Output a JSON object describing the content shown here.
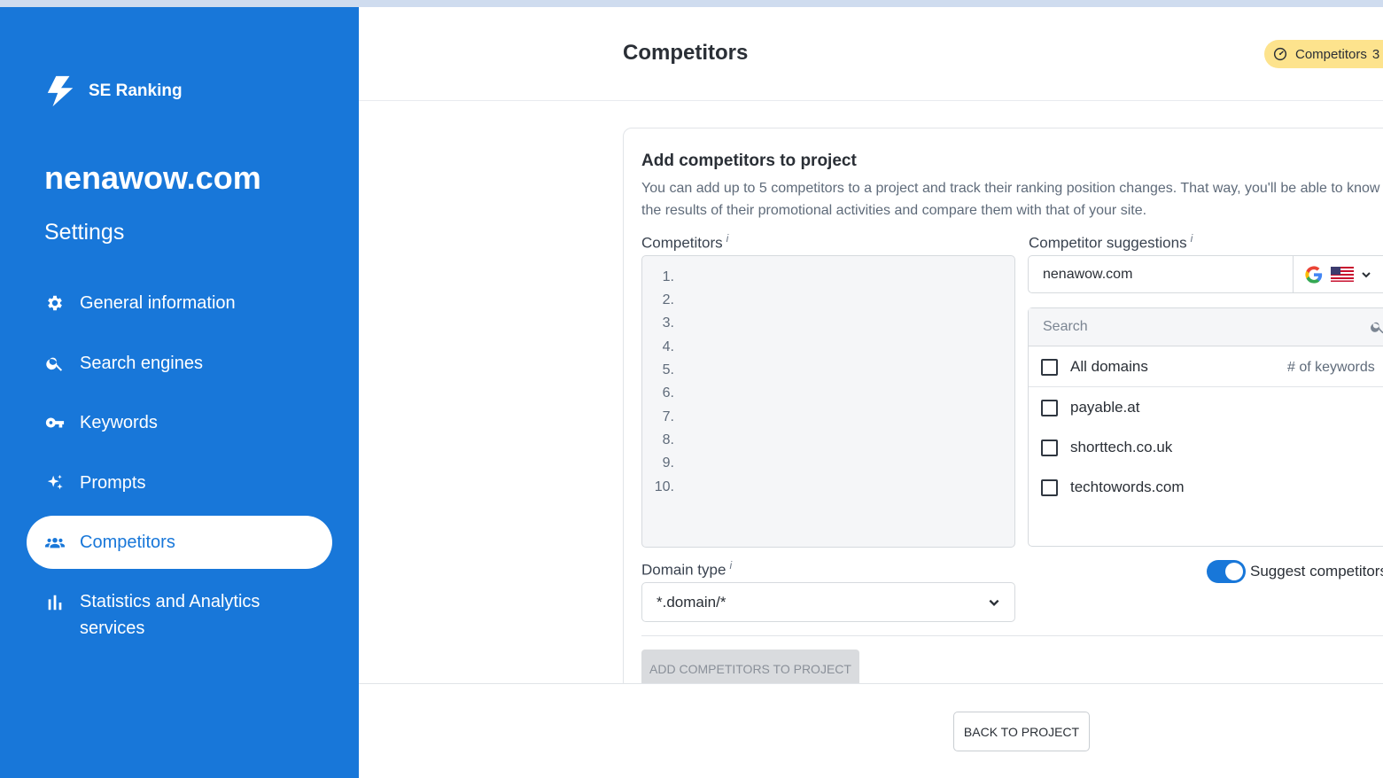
{
  "brand": {
    "name": "SE Ranking"
  },
  "project": {
    "name": "nenawow.com",
    "section": "Settings"
  },
  "nav": {
    "items": [
      {
        "label": "General information",
        "icon": "gear-icon",
        "active": false
      },
      {
        "label": "Search engines",
        "icon": "search-icon",
        "active": false
      },
      {
        "label": "Keywords",
        "icon": "key-icon",
        "active": false
      },
      {
        "label": "Prompts",
        "icon": "sparkle-icon",
        "active": false
      },
      {
        "label": "Competitors",
        "icon": "people-icon",
        "active": true
      },
      {
        "label": "Statistics and Analytics services",
        "icon": "bar-chart-icon",
        "active": false
      }
    ]
  },
  "header": {
    "title": "Competitors",
    "badge_label": "Competitors",
    "badge_count": "3"
  },
  "card": {
    "title": "Add competitors to project",
    "description": "You can add up to 5 competitors to a project and track their ranking position changes. That way, you'll be able to know the results of their promotional activities and compare them with that of your site.",
    "competitors_label": "Competitors",
    "info_mark": "i",
    "competitor_lines": [
      "1.",
      "2.",
      "3.",
      "4.",
      "5.",
      "6.",
      "7.",
      "8.",
      "9.",
      "10."
    ],
    "suggestions_label": "Competitor suggestions",
    "suggestions_domain": "nenawow.com",
    "search_placeholder": "Search",
    "all_domains_label": "All domains",
    "keywords_column": "# of keywords",
    "suggestions": [
      "payable.at",
      "shorttech.co.uk",
      "techtowords.com"
    ],
    "domain_type_label": "Domain type",
    "domain_type_value": "*.domain/*",
    "toggle_label": "Suggest competitors",
    "toggle_on": true,
    "add_button": "ADD COMPETITORS TO PROJECT"
  },
  "footer": {
    "back_button": "BACK TO PROJECT"
  },
  "colors": {
    "sidebar": "#1877d9",
    "badge": "#fde38d",
    "accent": "#1877d9"
  }
}
